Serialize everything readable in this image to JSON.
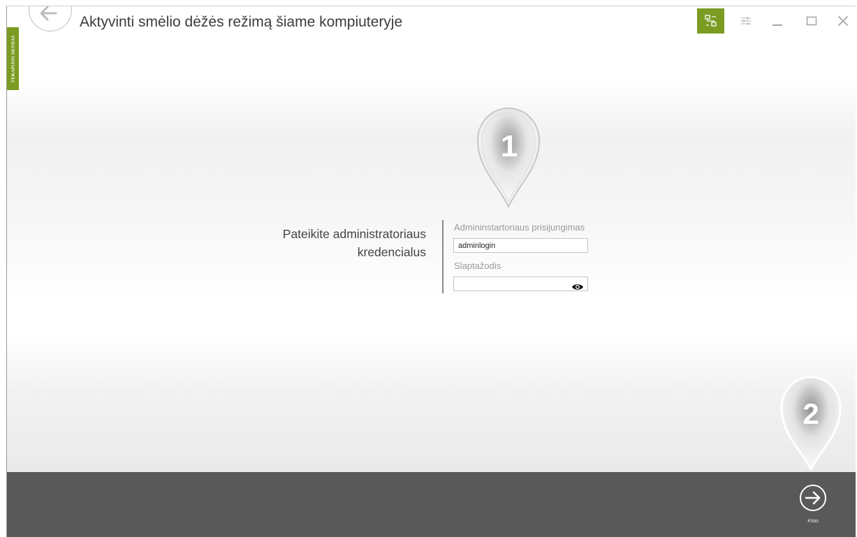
{
  "window": {
    "title": "Aktyvinti smėlio dėžės režimą šiame kompiuteryje",
    "side_tab_label": "TERAPIJOS SKYDAS"
  },
  "colors": {
    "accent": "#7a9c23",
    "bottom_bar": "#595959"
  },
  "icons": {
    "back": "arrow-left-icon",
    "network": "network-computers-icon",
    "settings": "sliders-icon",
    "minimize": "minimize-icon",
    "maximize": "maximize-icon",
    "close": "close-icon",
    "show_password": "eye-icon",
    "next": "arrow-right-icon"
  },
  "steps": {
    "step1": "1",
    "step2": "2"
  },
  "form": {
    "heading_line1": "Pateikite administratoriaus",
    "heading_line2": "kredencialus",
    "login_label": "Admininstartoriaus prisijungimas",
    "login_value": "adminlogin",
    "password_label": "Slaptažodis",
    "password_value": ""
  },
  "footer": {
    "next_label": "Kitas"
  }
}
